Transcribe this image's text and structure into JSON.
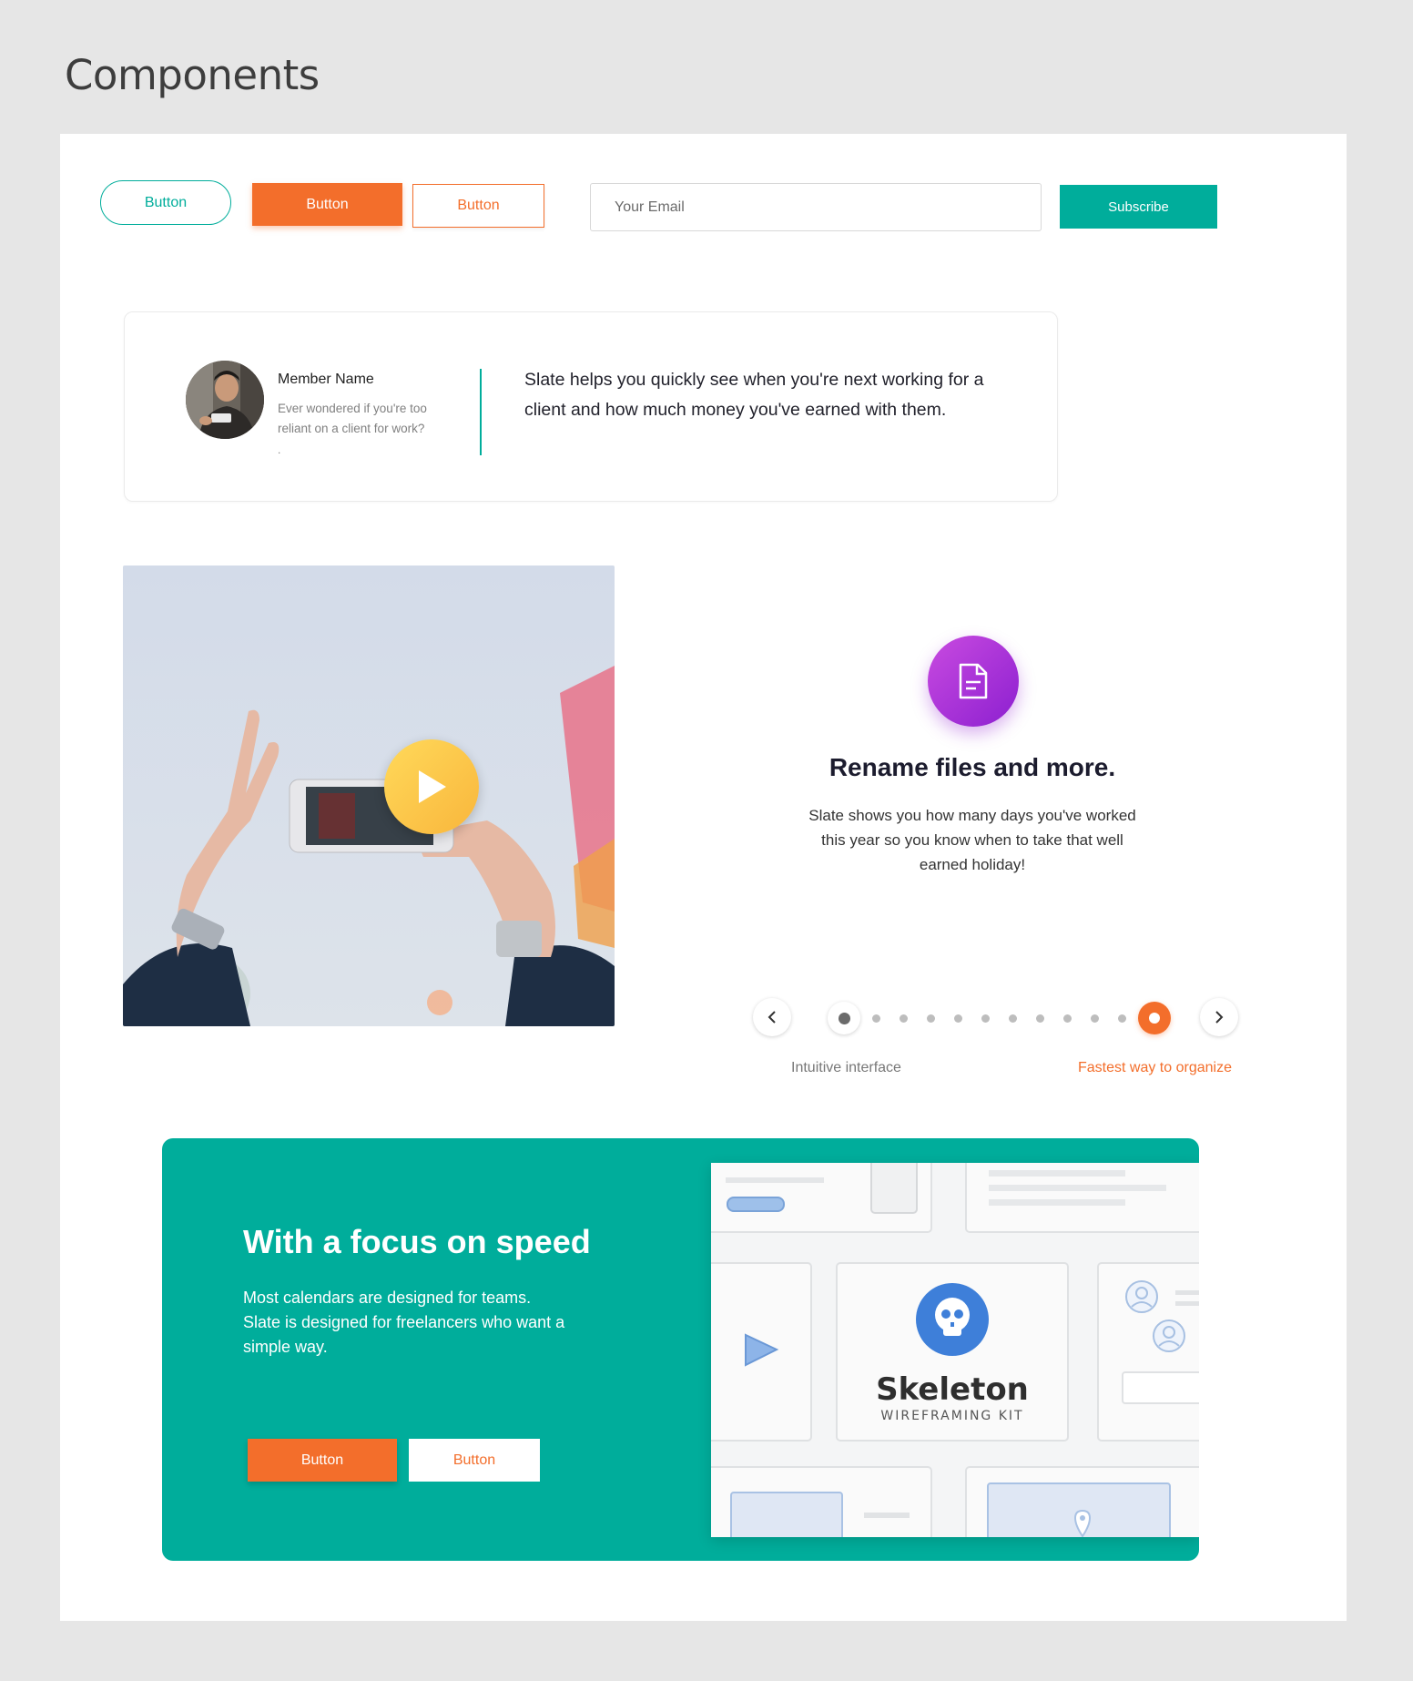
{
  "page": {
    "title": "Components"
  },
  "buttons_row": {
    "pill_label": "Button",
    "solid_label": "Button",
    "outline_label": "Button",
    "email_placeholder": "Your Email",
    "subscribe_label": "Subscribe"
  },
  "testimonial": {
    "member_name": "Member Name",
    "member_subtitle": "Ever wondered if you're too reliant on a client for work?",
    "member_dot": ".",
    "quote": "Slate helps you quickly see when you're next working for a client and how much money you've earned with them."
  },
  "feature": {
    "icon": "document-icon",
    "title": "Rename files and more.",
    "text_line1": "Slate shows you how many days you've worked",
    "text_rest": "this year so you know when to take that well earned holiday!"
  },
  "carousel": {
    "label_left": "Intuitive interface",
    "label_right": "Fastest way to organize",
    "dot_count": 12,
    "active_index": 11
  },
  "cta": {
    "title": "With a focus on speed",
    "text": "Most calendars are designed for teams. Slate is designed for freelancers who want a simple way.",
    "primary_label": "Button",
    "secondary_label": "Button"
  },
  "skeleton": {
    "brand": "Skeleton",
    "tagline": "WIREFRAMING KIT"
  },
  "colors": {
    "teal": "#00ad9b",
    "orange": "#f36e2b",
    "purple": "#a531d9",
    "yellow": "#fcc84a"
  }
}
